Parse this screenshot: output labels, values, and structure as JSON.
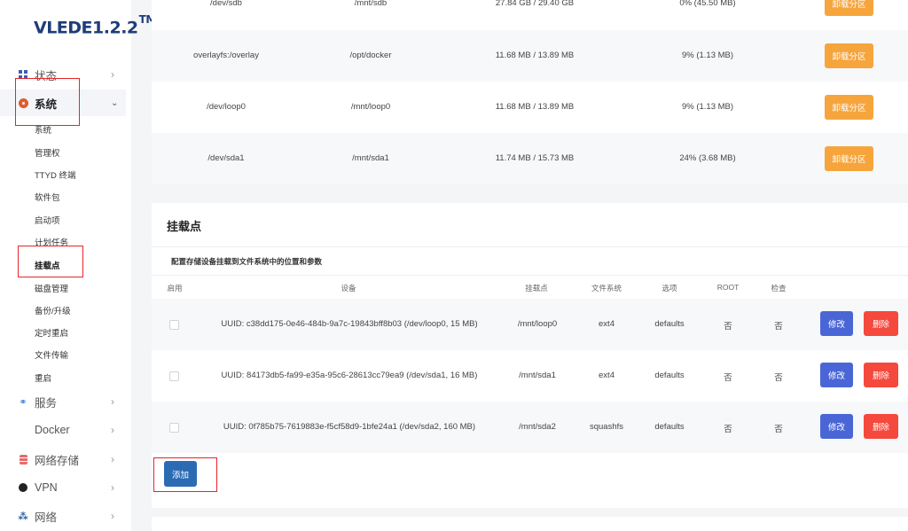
{
  "logo": {
    "text": "VLEDE1.2.2",
    "sup": "TM"
  },
  "sidebar": {
    "menu": [
      {
        "label": "状态"
      },
      {
        "label": "系统"
      },
      {
        "label": "服务"
      },
      {
        "label": "Docker"
      },
      {
        "label": "网络存储"
      },
      {
        "label": "VPN"
      },
      {
        "label": "网络"
      }
    ],
    "system_sub": [
      "系统",
      "管理权",
      "TTYD 终端",
      "软件包",
      "启动项",
      "计划任务",
      "挂载点",
      "磁盘管理",
      "备份/升级",
      "定时重启",
      "文件传输",
      "重启"
    ]
  },
  "partitions": [
    {
      "device": "/dev/sdb",
      "mount": "/mnt/sdb",
      "size": "27.84 GB / 29.40 GB",
      "usage": "0% (45.50 MB)",
      "action": "卸载分区"
    },
    {
      "device": "overlayfs:/overlay",
      "mount": "/opt/docker",
      "size": "11.68 MB / 13.89 MB",
      "usage": "9% (1.13 MB)",
      "action": "卸载分区"
    },
    {
      "device": "/dev/loop0",
      "mount": "/mnt/loop0",
      "size": "11.68 MB / 13.89 MB",
      "usage": "9% (1.13 MB)",
      "action": "卸载分区"
    },
    {
      "device": "/dev/sda1",
      "mount": "/mnt/sda1",
      "size": "11.74 MB / 15.73 MB",
      "usage": "24% (3.68 MB)",
      "action": "卸载分区"
    }
  ],
  "mounts_section": {
    "title": "挂载点",
    "description": "配置存储设备挂载到文件系统中的位置和参数",
    "headers": [
      "启用",
      "设备",
      "挂载点",
      "文件系统",
      "选项",
      "ROOT",
      "检查"
    ],
    "rows": [
      {
        "device": "UUID: c38dd175-0e46-484b-9a7c-19843bff8b03 (/dev/loop0, 15 MB)",
        "mount": "/mnt/loop0",
        "fs": "ext4",
        "options": "defaults",
        "root": "否",
        "check": "否"
      },
      {
        "device": "UUID: 84173db5-fa99-e35a-95c6-28613cc79ea9 (/dev/sda1, 16 MB)",
        "mount": "/mnt/sda1",
        "fs": "ext4",
        "options": "defaults",
        "root": "否",
        "check": "否"
      },
      {
        "device": "UUID: 0f785b75-7619883e-f5cf58d9-1bfe24a1 (/dev/sda2, 160 MB)",
        "mount": "/mnt/sda2",
        "fs": "squashfs",
        "options": "defaults",
        "root": "否",
        "check": "否"
      }
    ],
    "edit_label": "修改",
    "delete_label": "删除",
    "add_label": "添加"
  },
  "colors": {
    "orange": "#f6a53c",
    "blue": "#4a66d6",
    "red": "#f4493c",
    "add_blue": "#2a6bb3",
    "highlight_red": "#e4252b"
  }
}
